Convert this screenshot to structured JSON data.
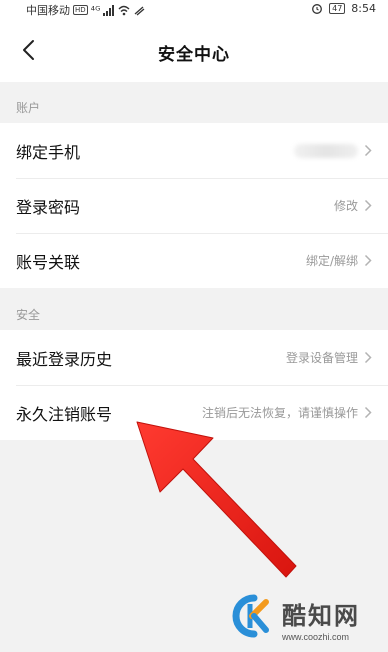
{
  "status_bar": {
    "carrier": "中国移动",
    "hd_badge": "HD",
    "signal": "⁴ᴳ",
    "battery": "47",
    "time": "8:54"
  },
  "header": {
    "title": "安全中心"
  },
  "sections": [
    {
      "header": "账户",
      "items": [
        {
          "label": "绑定手机",
          "value": ""
        },
        {
          "label": "登录密码",
          "value": "修改"
        },
        {
          "label": "账号关联",
          "value": "绑定/解绑"
        }
      ]
    },
    {
      "header": "安全",
      "items": [
        {
          "label": "最近登录历史",
          "value": "登录设备管理"
        },
        {
          "label": "永久注销账号",
          "value": "注销后无法恢复，请谨慎操作"
        }
      ]
    }
  ],
  "watermark": {
    "text": "酷知网",
    "url": "www.coozhi.com"
  },
  "colors": {
    "arrow": "#e8231c",
    "chevron": "#b3b3b3",
    "logo_blue": "#2a8fd8",
    "logo_orange": "#f39a1e"
  }
}
